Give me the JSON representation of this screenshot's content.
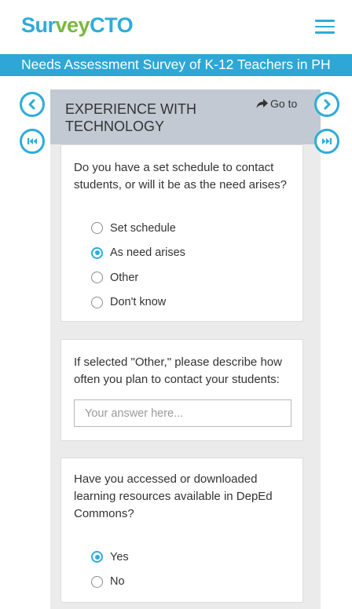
{
  "brand": {
    "logo_part1": "Sur",
    "logo_part2": "vey",
    "logo_part3": "CTO"
  },
  "header": {
    "survey_title": "Needs Assessment Survey of K-12 Teachers in PH"
  },
  "section": {
    "title": "EXPERIENCE WITH TECHNOLOGY",
    "goto_label": "Go to"
  },
  "q1": {
    "text": "Do you have a set schedule to contact students, or will it be as the need arises?",
    "options": [
      "Set schedule",
      "As need arises",
      "Other",
      "Don't know"
    ],
    "selected": "As need arises"
  },
  "q2": {
    "text": "If selected \"Other,\" please describe how often you plan to contact your students:",
    "placeholder": "Your answer here..."
  },
  "q3": {
    "text": "Have you accessed or downloaded learning resources available in DepEd Commons?",
    "options": [
      "Yes",
      "No"
    ],
    "selected": "Yes"
  },
  "colors": {
    "accent": "#2eacd9",
    "brand_green": "#7ab842",
    "header_gray": "#c3c9d3"
  },
  "icons": {
    "menu": "hamburger-icon",
    "prev": "chevron-left-icon",
    "next": "chevron-right-icon",
    "first": "skip-first-icon",
    "last": "skip-last-icon",
    "goto": "share-arrow-icon"
  }
}
